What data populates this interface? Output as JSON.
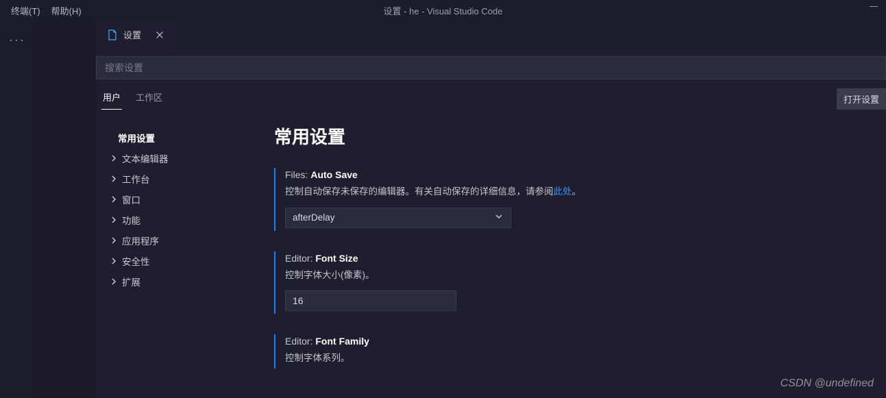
{
  "menubar": {
    "terminal": "终端(T)",
    "terminal_hint": "T",
    "help": "帮助(H)",
    "help_hint": "H"
  },
  "window": {
    "title": "设置 - he - Visual Studio Code"
  },
  "tab": {
    "label": "设置"
  },
  "search": {
    "placeholder": "搜索设置"
  },
  "scope": {
    "user": "用户",
    "workspace": "工作区",
    "open_json": "打开设置"
  },
  "toc": {
    "header": "常用设置",
    "items": [
      "文本编辑器",
      "工作台",
      "窗口",
      "功能",
      "应用程序",
      "安全性",
      "扩展"
    ]
  },
  "section": {
    "title": "常用设置"
  },
  "settings": {
    "autoSave": {
      "scope": "Files: ",
      "name": "Auto Save",
      "desc_pre": "控制自动保存未保存的编辑器。有关自动保存的详细信息，请参阅",
      "link": "此处",
      "desc_post": "。",
      "value": "afterDelay"
    },
    "fontSize": {
      "scope": "Editor: ",
      "name": "Font Size",
      "desc": "控制字体大小(像素)。",
      "value": "16"
    },
    "fontFamily": {
      "scope": "Editor: ",
      "name": "Font Family",
      "desc": "控制字体系列。"
    }
  },
  "watermark": "CSDN @undefined"
}
